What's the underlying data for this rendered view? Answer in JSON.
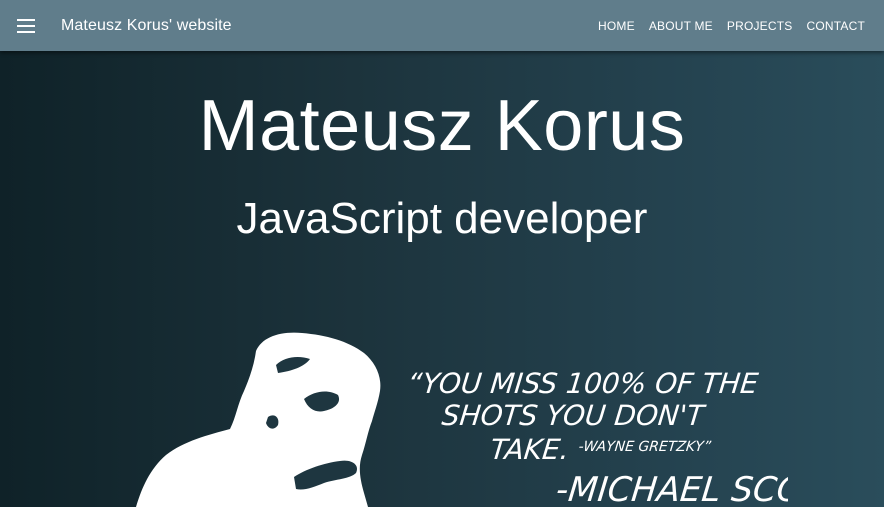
{
  "navbar": {
    "menu_icon": "hamburger-menu-icon",
    "brand": "Mateusz Korus' website",
    "links": [
      "HOME",
      "ABOUT ME",
      "PROJECTS",
      "CONTACT"
    ]
  },
  "hero": {
    "title": "Mateusz Korus",
    "subtitle": "JavaScript developer"
  },
  "quote": {
    "line1": "“YOU MISS 100% OF THE",
    "line2": "SHOTS YOU DON'T",
    "line3": "TAKE.",
    "attribution_inner": "-WAYNE GRETZKY”",
    "signature": "-MICHAEL SCOTT"
  },
  "colors": {
    "navbar": "#607d8b",
    "hero_gradient_start": "#0f2228",
    "hero_gradient_end": "#2a4d5b",
    "text": "#ffffff"
  }
}
